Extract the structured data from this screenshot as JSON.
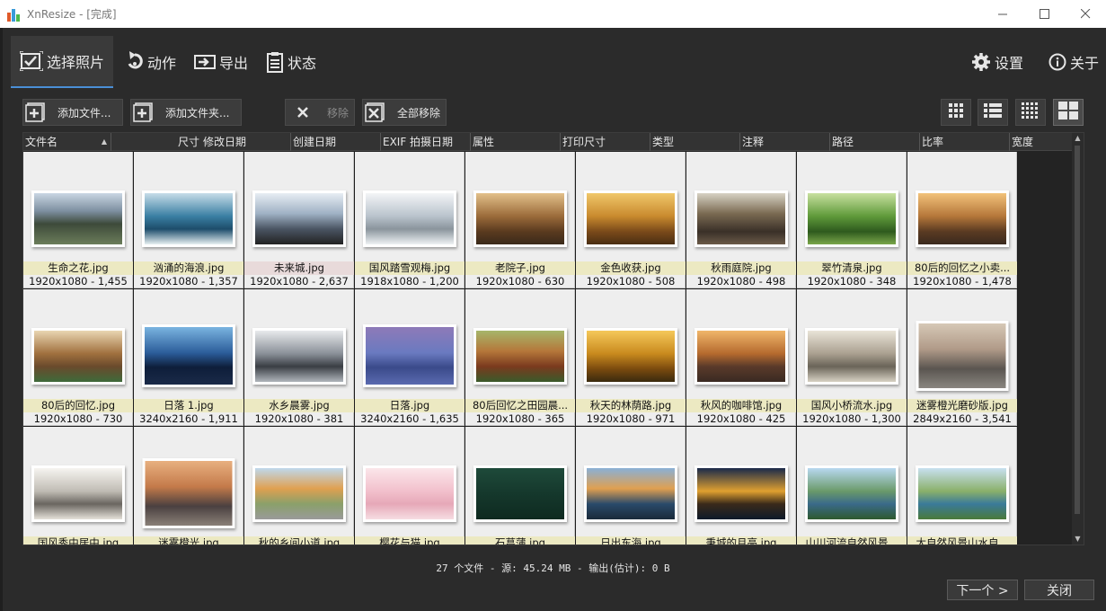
{
  "window": {
    "app_title": "XnResize - [完成]",
    "min_icon": "minimize-icon",
    "max_icon": "maximize-icon",
    "close_icon": "close-icon"
  },
  "nav": {
    "tabs": [
      {
        "label": "选择照片",
        "icon": "select-photos-icon",
        "active": true
      },
      {
        "label": "动作",
        "icon": "actions-icon",
        "active": false
      },
      {
        "label": "导出",
        "icon": "export-icon",
        "active": false
      },
      {
        "label": "状态",
        "icon": "status-icon",
        "active": false
      }
    ],
    "settings_label": "设置",
    "about_label": "关于"
  },
  "toolbar": {
    "add_files": "添加文件...",
    "add_folder": "添加文件夹...",
    "remove": "移除",
    "remove_all": "全部移除"
  },
  "columns": [
    "文件名",
    "尺寸",
    "修改日期",
    "创建日期",
    "EXIF 拍摄日期",
    "属性",
    "打印尺寸",
    "类型",
    "注释",
    "路径",
    "比率",
    "宽度"
  ],
  "sort": {
    "column": "文件名",
    "direction": "ascending"
  },
  "files": [
    {
      "name": "生命之花.jpg",
      "meta": "1920x1080 - 1,455"
    },
    {
      "name": "汹涌的海浪.jpg",
      "meta": "1920x1080 - 1,357"
    },
    {
      "name": "未来城.jpg",
      "meta": "1920x1080 - 2,637"
    },
    {
      "name": "国风踏雪观梅.jpg",
      "meta": "1918x1080 - 1,200"
    },
    {
      "name": "老院子.jpg",
      "meta": "1920x1080 - 630"
    },
    {
      "name": "金色收获.jpg",
      "meta": "1920x1080 - 508"
    },
    {
      "name": "秋雨庭院.jpg",
      "meta": "1920x1080 - 498"
    },
    {
      "name": "翠竹清泉.jpg",
      "meta": "1920x1080 - 348"
    },
    {
      "name": "80后的回忆之小卖...",
      "meta": "1920x1080 - 1,478"
    },
    {
      "name": "80后的回忆.jpg",
      "meta": "1920x1080 - 730"
    },
    {
      "name": "日落 1.jpg",
      "meta": "3240x2160 - 1,911"
    },
    {
      "name": "水乡晨雾.jpg",
      "meta": "1920x1080 - 381"
    },
    {
      "name": "日落.jpg",
      "meta": "3240x2160 - 1,635"
    },
    {
      "name": "80后回忆之田园晨...",
      "meta": "1920x1080 - 365"
    },
    {
      "name": "秋天的林荫路.jpg",
      "meta": "1920x1080 - 971"
    },
    {
      "name": "秋风的咖啡馆.jpg",
      "meta": "1920x1080 - 425"
    },
    {
      "name": "国风小桥流水.jpg",
      "meta": "1920x1080 - 1,300"
    },
    {
      "name": "迷雾橙光磨砂版.jpg",
      "meta": "2849x2160 - 3,541"
    },
    {
      "name": "国风秀中居中.jpg",
      "meta": ""
    },
    {
      "name": "迷雾橙光.jpg",
      "meta": ""
    },
    {
      "name": "秋的乡间小道.jpg",
      "meta": ""
    },
    {
      "name": "樱花与猫.jpg",
      "meta": ""
    },
    {
      "name": "石菖蒲.jpg",
      "meta": ""
    },
    {
      "name": "日出东海.jpg",
      "meta": ""
    },
    {
      "name": "秉城的月亮.jpg",
      "meta": ""
    },
    {
      "name": "山川河流自然风景...",
      "meta": ""
    },
    {
      "name": "大自然风景山水自...",
      "meta": ""
    }
  ],
  "selected_file": "未来城.jpg",
  "status_text": "27 个文件 - 源: 45.24 MB - 输出(估计): 0 B",
  "footer": {
    "next_label": "下一个 >",
    "close_label": "关闭"
  },
  "colors": {
    "accent": "#4a8fd6",
    "caption_bg": "#ece9c2",
    "selected_caption_bg": "#e8dada"
  }
}
